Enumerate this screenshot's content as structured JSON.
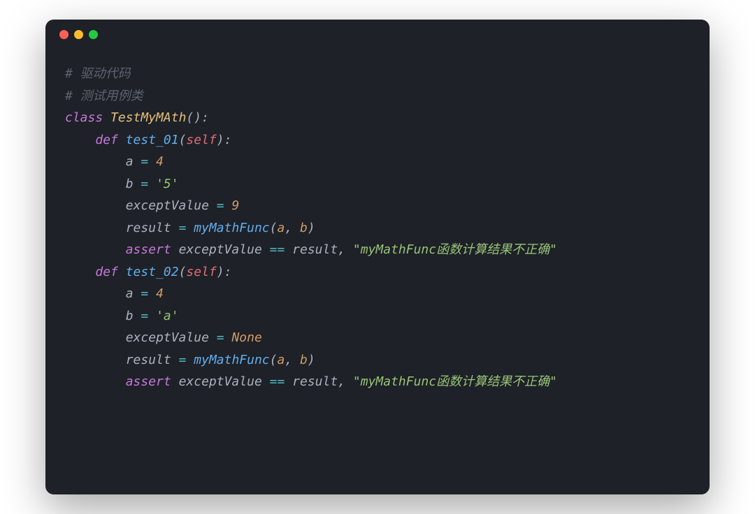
{
  "code": {
    "comment1": "# 驱动代码",
    "comment2": "# 测试用例类",
    "kw_class": "class",
    "class_name": "TestMyMAth",
    "kw_def": "def",
    "fn_test01": "test_01",
    "fn_test02": "test_02",
    "self": "self",
    "var_a": "a",
    "var_b": "b",
    "var_exceptValue": "exceptValue",
    "var_result": "result",
    "fn_myMathFunc": "myMathFunc",
    "kw_assert": "assert",
    "kw_none": "None",
    "op_eq": "=",
    "op_eqeq": "==",
    "num_4": "4",
    "num_9": "9",
    "str_5": "'5'",
    "str_a": "'a'",
    "assert_msg": "\"myMathFunc函数计算结果不正确\"",
    "comma": ",",
    "colon": ":",
    "lparen": "(",
    "rparen": ")"
  }
}
